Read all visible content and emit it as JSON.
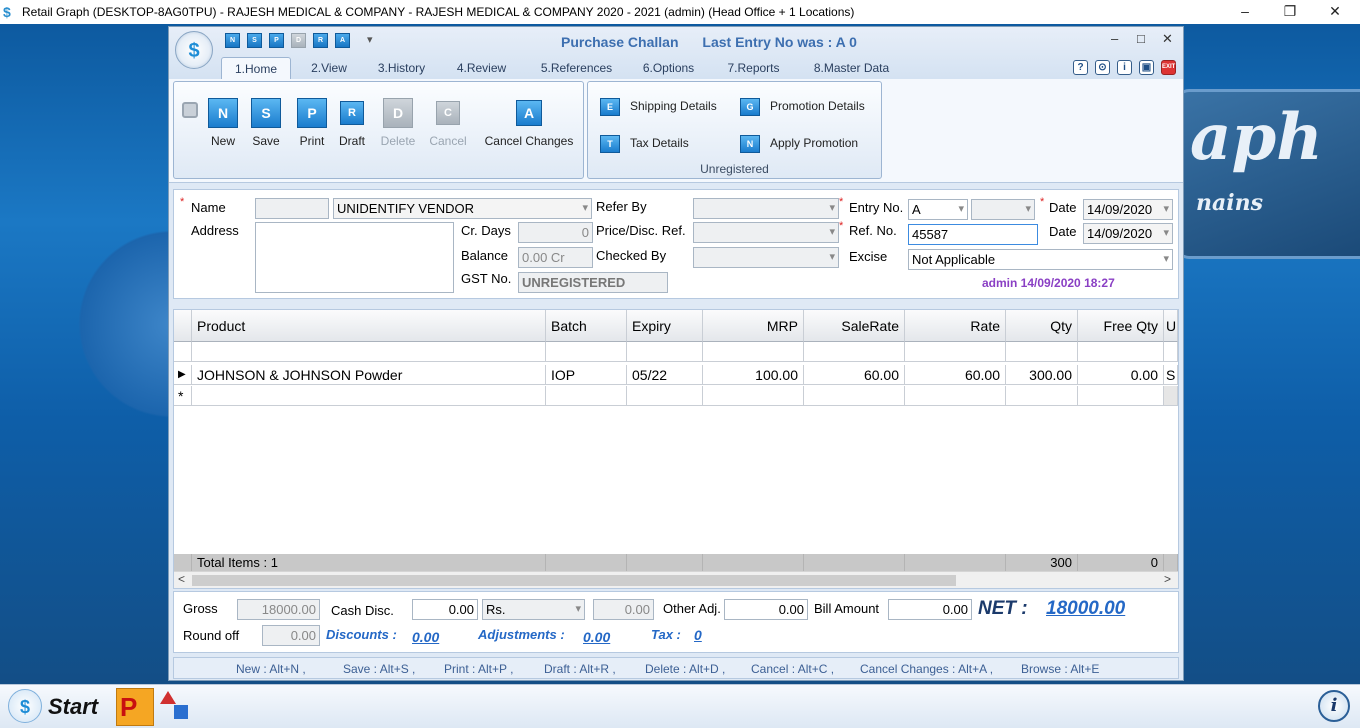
{
  "titlebar": {
    "title": "Retail Graph (DESKTOP-8AG0TPU) - RAJESH MEDICAL & COMPANY - RAJESH MEDICAL & COMPANY  2020 - 2021 (admin) (Head Office + 1 Locations)",
    "minimize": "–",
    "maximize": "❐",
    "close": "✕"
  },
  "background_logo": {
    "big": "aph",
    "small": "nains"
  },
  "window": {
    "title": "Purchase Challan",
    "last_entry": "Last Entry No was : A 0",
    "controls": {
      "minimize": "–",
      "maximize": "□",
      "close": "✕"
    },
    "quick_access": [
      "N",
      "S",
      "P",
      "D",
      "R",
      "A"
    ],
    "qa_more": "▾"
  },
  "tabs": [
    "1.Home",
    "2.View",
    "3.History",
    "4.Review",
    "5.References",
    "6.Options",
    "7.Reports",
    "8.Master Data"
  ],
  "active_tab": "1.Home",
  "header_icons": [
    "?",
    "⊙",
    "i",
    "▣",
    "EXIT"
  ],
  "ribbon": {
    "lock_icon": "lock-icon",
    "buttons": [
      {
        "label": "New",
        "icon": "N",
        "enabled": true
      },
      {
        "label": "Save",
        "icon": "S",
        "enabled": true
      },
      {
        "label": "Print",
        "icon": "P",
        "enabled": true
      },
      {
        "label": "Draft",
        "icon": "R",
        "enabled": true
      },
      {
        "label": "Delete",
        "icon": "D",
        "enabled": false
      },
      {
        "label": "Cancel",
        "icon": "C",
        "enabled": false
      },
      {
        "label": "Cancel Changes",
        "icon": "A",
        "enabled": true
      }
    ],
    "extra": {
      "shipping": "Shipping Details",
      "promotion": "Promotion Details",
      "tax": "Tax Details",
      "apply_promotion": "Apply Promotion",
      "shipping_icon": "E",
      "promotion_icon": "G",
      "tax_icon": "T",
      "apply_icon": "N",
      "group_label": "Unregistered"
    }
  },
  "form": {
    "name_label": "Name",
    "name_code": "",
    "name_value": "UNIDENTIFY VENDOR",
    "address_label": "Address",
    "address_value": "",
    "cr_days_label": "Cr. Days",
    "cr_days_value": "0",
    "balance_label": "Balance",
    "balance_value": "0.00 Cr",
    "gst_label": "GST No.",
    "gst_value": "UNREGISTERED",
    "refer_by_label": "Refer By",
    "price_disc_label": "Price/Disc. Ref.",
    "checked_by_label": "Checked By",
    "entry_no_label": "Entry No.",
    "entry_no_value": "A",
    "ref_no_label": "Ref. No.",
    "ref_no_value": "45587",
    "excise_label": "Excise",
    "excise_value": "Not Applicable",
    "date_label": "Date",
    "date_value": "14/09/2020",
    "date2_label": "Date",
    "date2_value": "14/09/2020",
    "stamp": "admin 14/09/2020 18:27",
    "required_mark": "*"
  },
  "grid": {
    "columns": [
      "Product",
      "Batch",
      "Expiry",
      "MRP",
      "SaleRate",
      "Rate",
      "Qty",
      "Free Qty",
      "U"
    ],
    "rows": [
      [
        "JOHNSON & JOHNSON Powder",
        "IOP",
        "05/22",
        "100.00",
        "60.00",
        "60.00",
        "300.00",
        "0.00",
        "S"
      ]
    ],
    "current_marker": "▶",
    "new_marker": "*",
    "footer_label": "Total Items : 1",
    "footer_qty": "300",
    "footer_free": "0",
    "scroll_left": "<",
    "scroll_right": ">"
  },
  "totals": {
    "gross_label": "Gross",
    "gross_value": "18000.00",
    "cash_disc_label": "Cash Disc.",
    "cash_disc_value": "0.00",
    "cash_disc_type": "Rs.",
    "cash_disc_amount": "0.00",
    "other_adj_label": "Other Adj.",
    "other_adj_value": "0.00",
    "bill_amount_label": "Bill Amount",
    "bill_amount_value": "0.00",
    "net_label": "NET :",
    "net_value": "18000.00",
    "round_off_label": "Round off",
    "round_off_value": "0.00",
    "discounts_label": "Discounts :",
    "discounts_value": "0.00",
    "adjustments_label": "Adjustments :",
    "adjustments_value": "0.00",
    "tax_label": "Tax :",
    "tax_value": "0"
  },
  "hotkeys": [
    "New : Alt+N ,",
    "Save : Alt+S ,",
    "Print : Alt+P ,",
    "Draft : Alt+R ,",
    "Delete : Alt+D ,",
    "Cancel : Alt+C ,",
    "Cancel Changes : Alt+A ,",
    "Browse : Alt+E"
  ],
  "taskbar": {
    "start": "Start",
    "info": "i",
    "app_letter": "P"
  },
  "colors": {
    "accent": "#1a7ccd",
    "title_blue": "#3d6fb0",
    "stamp_purple": "#8a3fc4",
    "link_blue": "#2468c6",
    "required_red": "#d22222"
  }
}
